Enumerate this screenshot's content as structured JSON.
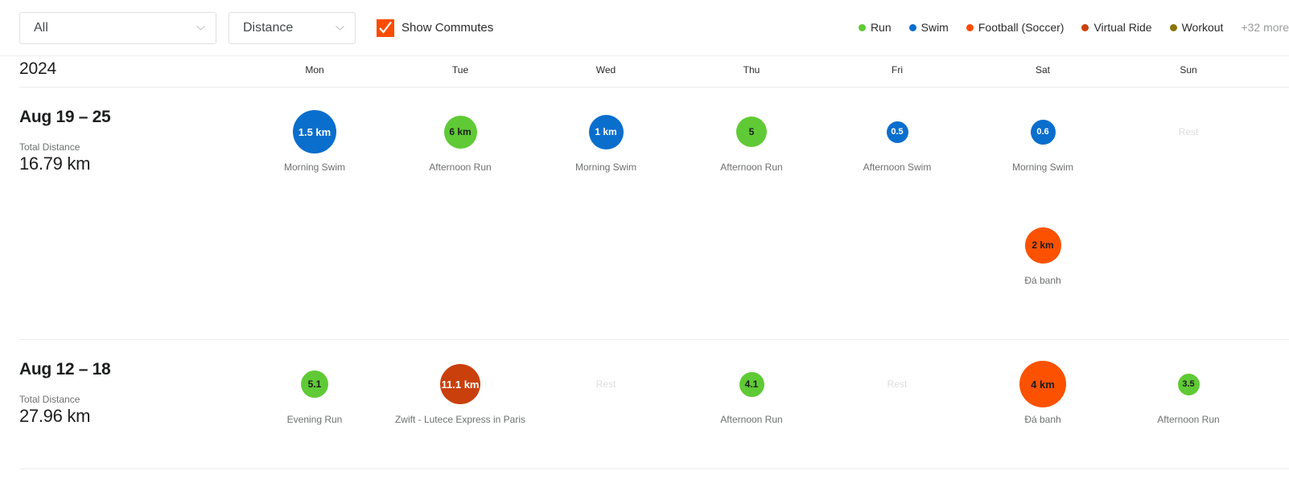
{
  "toolbar": {
    "activity_filter": {
      "value": "All",
      "icon": "chevron-down-icon"
    },
    "sort_filter": {
      "value": "Distance",
      "icon": "chevron-down-icon"
    },
    "show_commutes": {
      "label": "Show Commutes",
      "checked": true,
      "color": "#fc4c02"
    },
    "legend": {
      "items": [
        {
          "label": "Run",
          "color": "#5fca35"
        },
        {
          "label": "Swim",
          "color": "#0a6ecd"
        },
        {
          "label": "Football (Soccer)",
          "color": "#fc4c02"
        },
        {
          "label": "Virtual Ride",
          "color": "#c9400d"
        },
        {
          "label": "Workout",
          "color": "#8a7408"
        }
      ],
      "more_label": "+32 more"
    }
  },
  "grid": {
    "year": "2024",
    "days": [
      "Mon",
      "Tue",
      "Wed",
      "Thu",
      "Fri",
      "Sat",
      "Sun"
    ],
    "rest_label": "Rest",
    "weeks": [
      {
        "range": "Aug 19 – 25",
        "total_label": "Total Distance",
        "total_value": "16.79 km",
        "rows": [
          [
            {
              "value": "1.5 km",
              "name": "Morning Swim",
              "color": "#0a6ecd",
              "text_color": "#ffffff",
              "size": 54,
              "font": 13
            },
            {
              "value": "6 km",
              "name": "Afternoon Run",
              "color": "#5fca35",
              "text_color": "#1c1d1e",
              "size": 41,
              "font": 12
            },
            {
              "value": "1 km",
              "name": "Morning Swim",
              "color": "#0a6ecd",
              "text_color": "#ffffff",
              "size": 43,
              "font": 12
            },
            {
              "value": "5",
              "name": "Afternoon Run",
              "color": "#5fca35",
              "text_color": "#1c1d1e",
              "size": 38,
              "font": 12
            },
            {
              "value": "0.5",
              "name": "Afternoon Swim",
              "color": "#0a6ecd",
              "text_color": "#ffffff",
              "size": 27,
              "font": 11
            },
            {
              "value": "0.6",
              "name": "Morning Swim",
              "color": "#0a6ecd",
              "text_color": "#ffffff",
              "size": 31,
              "font": 11
            },
            {
              "rest": true
            }
          ],
          [
            {
              "empty": true
            },
            {
              "empty": true
            },
            {
              "empty": true
            },
            {
              "empty": true
            },
            {
              "empty": true
            },
            {
              "value": "2 km",
              "name": "Đá banh",
              "color": "#fc5200",
              "text_color": "#1c1d1e",
              "size": 45,
              "font": 12
            },
            {
              "empty": true
            }
          ]
        ]
      },
      {
        "range": "Aug 12 – 18",
        "total_label": "Total Distance",
        "total_value": "27.96 km",
        "rows": [
          [
            {
              "value": "5.1",
              "name": "Evening Run",
              "color": "#5fca35",
              "text_color": "#1c1d1e",
              "size": 34,
              "font": 12
            },
            {
              "value": "11.1 km",
              "name": "Zwift - Lutece Express in Paris",
              "color": "#c9400d",
              "text_color": "#ffffff",
              "size": 50,
              "font": 13
            },
            {
              "rest": true
            },
            {
              "value": "4.1",
              "name": "Afternoon Run",
              "color": "#5fca35",
              "text_color": "#1c1d1e",
              "size": 31,
              "font": 12
            },
            {
              "rest": true
            },
            {
              "value": "4 km",
              "name": "Đá banh",
              "color": "#fc5200",
              "text_color": "#1c1d1e",
              "size": 58,
              "font": 13
            },
            {
              "value": "3.5",
              "name": "Afternoon Run",
              "color": "#5fca35",
              "text_color": "#1c1d1e",
              "size": 27,
              "font": 11
            }
          ]
        ]
      }
    ]
  }
}
